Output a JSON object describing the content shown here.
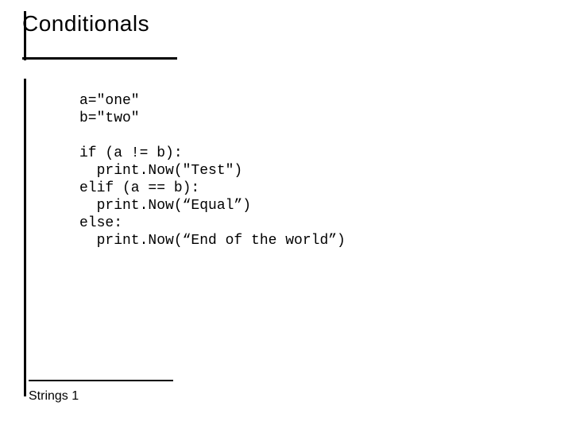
{
  "slide": {
    "title": "Conditionals",
    "footer": "Strings 1",
    "code": "a=\"one\"\nb=\"two\"\n\nif (a != b):\n  print.Now(\"Test\")\nelif (a == b):\n  print.Now(“Equal”)\nelse:\n  print.Now(“End of the world”)"
  }
}
